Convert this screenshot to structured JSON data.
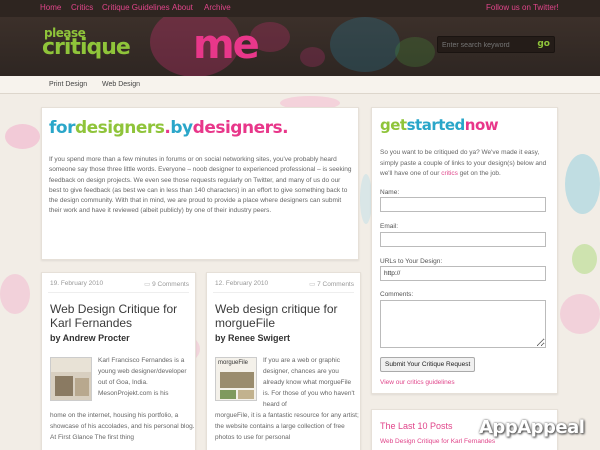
{
  "colors": {
    "pink": "#e8378a",
    "green": "#8fc43a",
    "blue": "#2aa6c9",
    "dark": "#2e2520"
  },
  "topnav": {
    "items": [
      "Home",
      "Critics",
      "Critique Guidelines",
      "About",
      "Archive"
    ],
    "twitter": "Follow us on Twitter!"
  },
  "logo": {
    "please": "please",
    "critique": "critique",
    "me": "me"
  },
  "search": {
    "placeholder": "Enter search keyword",
    "go_icon": "go-arrow-icon",
    "go_text": "go"
  },
  "subnav": {
    "items": [
      "Print Design",
      "Web Design"
    ]
  },
  "intro": {
    "tagline": {
      "for": "for",
      "designers1": "designers",
      "dot": ".",
      "by": "by",
      "designers2": "designers",
      "end": "."
    },
    "text": "If you spend more than a few minutes in forums or on social networking sites, you've probably heard someone say those three little words. Everyone – noob designer to experienced professional – is seeking feedback on design projects. We even see those requests regularly on Twitter, and many of us do our best to give feedback (as best we can in less than 140 characters) in an effort to give something back to the design community. With that in mind, we are proud to provide a place where designers can submit their work and have it reviewed (albeit publicly) by one of their industry peers."
  },
  "posts": [
    {
      "date": "19. February 2010",
      "comments": "9 Comments",
      "title": "Web Design Critique for Karl Fernandes",
      "author": "by Andrew Procter",
      "thumb_label": "",
      "body": "Karl Francisco Fernandes is a young web designer/developer out of Goa, India. MesonProjekt.com is his",
      "body_full": "home on the internet, housing his portfolio, a showcase of his accolades, and his personal blog. At First Glance The first thing"
    },
    {
      "date": "12. February 2010",
      "comments": "7 Comments",
      "title": "Web design critique for morgueFile",
      "author": "by Renee Swigert",
      "thumb_label": "morgueFile",
      "body": "If you are a web or graphic designer, chances are you already know what morgueFile is. For those of you who haven't heard of",
      "body_full": "morgueFile, it is a fantastic resource for any artist; the website contains a large collection of free photos to use for personal"
    }
  ],
  "sidebar": {
    "title": {
      "get": "get",
      "started": "started",
      "now": "now"
    },
    "text_before": "So you want to be critiqued do ya? We've made it easy, simply paste a couple of links to your design(s) below and we'll have one of our ",
    "text_link": "critics",
    "text_after": " get on the job.",
    "name_label": "Name:",
    "email_label": "Email:",
    "url_label": "URLs to Your Design:",
    "url_value": "http://",
    "comments_label": "Comments:",
    "submit": "Submit Your Critique Request",
    "guidelines_link": "View our critics guidelines"
  },
  "last10": {
    "title": "The Last 10 Posts",
    "first_item": "Web Design Critique for Karl Fernandes"
  },
  "watermark": "AppAppeal"
}
